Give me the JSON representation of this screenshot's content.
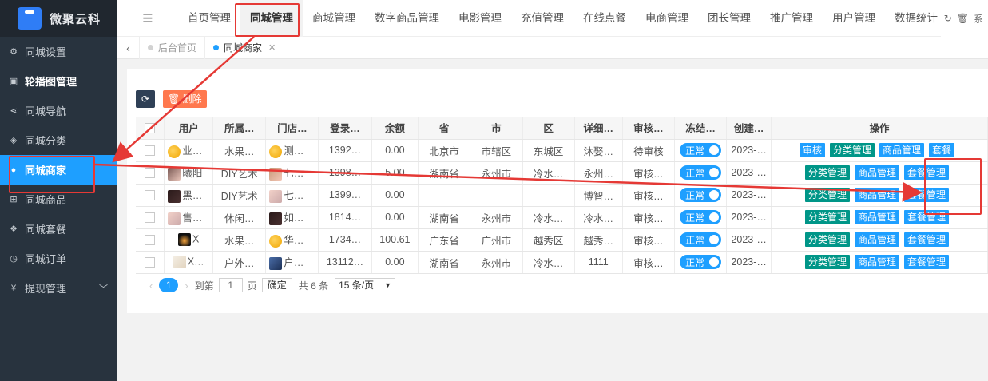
{
  "brand": {
    "name": "微聚云科"
  },
  "sidebar": {
    "items": [
      {
        "label": "同城设置",
        "icon": "gear-icon",
        "glyph": "⚙"
      },
      {
        "label": "轮播图管理",
        "icon": "image-icon",
        "glyph": "▣"
      },
      {
        "label": "同城导航",
        "icon": "share-icon",
        "glyph": "⋖"
      },
      {
        "label": "同城分类",
        "icon": "tag-icon",
        "glyph": "◈"
      },
      {
        "label": "同城商家",
        "icon": "location-pin-icon",
        "glyph": "●"
      },
      {
        "label": "同城商品",
        "icon": "cart-icon",
        "glyph": "⊞"
      },
      {
        "label": "同城套餐",
        "icon": "cubes-icon",
        "glyph": "❖"
      },
      {
        "label": "同城订单",
        "icon": "clock-icon",
        "glyph": "◷"
      },
      {
        "label": "提现管理",
        "icon": "yen-icon",
        "glyph": "¥"
      }
    ]
  },
  "topnav": {
    "items": [
      "首页管理",
      "同城管理",
      "商城管理",
      "数字商品管理",
      "电影管理",
      "充值管理",
      "在线点餐",
      "电商管理",
      "团长管理",
      "推广管理",
      "用户管理"
    ],
    "overflow_label": "数据统计",
    "tool_icons": [
      "refresh-icon",
      "trash-icon"
    ],
    "tool_trailing": "系"
  },
  "tabs": [
    {
      "label": "后台首页"
    },
    {
      "label": "同城商家"
    }
  ],
  "toolbar": {
    "refresh": "⟳",
    "delete_label": "删除"
  },
  "table": {
    "columns": [
      "用户",
      "所属…",
      "门店…",
      "登录…",
      "余额",
      "省",
      "市",
      "区",
      "详细…",
      "审核…",
      "冻结…",
      "创建…",
      "操作"
    ],
    "rows": [
      {
        "user": "业…",
        "cat": "水果…",
        "store": "测…",
        "login": "1392…",
        "balance": "0.00",
        "prov": "北京市",
        "city": "市辖区",
        "dist": "东城区",
        "addr": "沐娶…",
        "audit": "待审核",
        "freeze": "正常",
        "created": "2023-…",
        "ops": [
          "审核",
          "分类管理",
          "商品管理",
          "套餐"
        ]
      },
      {
        "user": "曦阳",
        "cat": "DIY艺术",
        "store": "七…",
        "login": "1398…",
        "balance": "5.00",
        "prov": "湖南省",
        "city": "永州市",
        "dist": "冷水…",
        "addr": "永州…",
        "audit": "审核…",
        "freeze": "正常",
        "created": "2023-…",
        "ops": [
          "分类管理",
          "商品管理",
          "套餐管理"
        ]
      },
      {
        "user": "黑…",
        "cat": "DIY艺术",
        "store": "七…",
        "login": "1399…",
        "balance": "0.00",
        "prov": "",
        "city": "",
        "dist": "",
        "addr": "博智…",
        "audit": "审核…",
        "freeze": "正常",
        "created": "2023-…",
        "ops": [
          "分类管理",
          "商品管理",
          "套餐管理"
        ]
      },
      {
        "user": "售…",
        "cat": "休闲…",
        "store": "如…",
        "login": "1814…",
        "balance": "0.00",
        "prov": "湖南省",
        "city": "永州市",
        "dist": "冷水…",
        "addr": "冷水…",
        "audit": "审核…",
        "freeze": "正常",
        "created": "2023-…",
        "ops": [
          "分类管理",
          "商品管理",
          "套餐管理"
        ]
      },
      {
        "user": "X",
        "cat": "水果…",
        "store": "华…",
        "login": "1734…",
        "balance": "100.61",
        "prov": "广东省",
        "city": "广州市",
        "dist": "越秀区",
        "addr": "越秀…",
        "audit": "审核…",
        "freeze": "正常",
        "created": "2023-…",
        "ops": [
          "分类管理",
          "商品管理",
          "套餐管理"
        ]
      },
      {
        "user": "X…",
        "cat": "户外…",
        "store": "户…",
        "login": "13112…",
        "balance": "0.00",
        "prov": "湖南省",
        "city": "永州市",
        "dist": "冷水…",
        "addr": "1111",
        "audit": "审核…",
        "freeze": "正常",
        "created": "2023-…",
        "ops": [
          "分类管理",
          "商品管理",
          "套餐管理"
        ]
      }
    ]
  },
  "pager": {
    "current": "1",
    "goto_label": "到第",
    "page_input": "1",
    "page_suffix": "页",
    "confirm": "确定",
    "total": "共 6 条",
    "page_size": "15 条/页"
  },
  "colors": {
    "accent": "#1e9fff",
    "green": "#009688",
    "sidebar": "#28333e",
    "annotation": "#e53935"
  }
}
